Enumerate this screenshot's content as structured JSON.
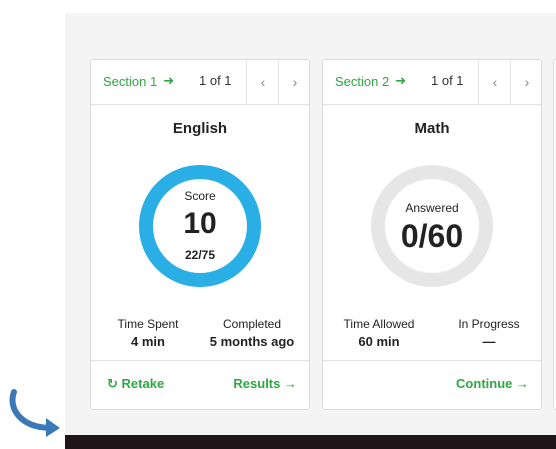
{
  "cards": [
    {
      "section_label": "Section 1",
      "page_count": "1 of 1",
      "subject": "English",
      "ring_label": "Score",
      "ring_value": "10",
      "ring_sub": "22/75",
      "ring_progress": 1.0,
      "ring_color": "#29aee6",
      "stat_left_label": "Time Spent",
      "stat_left_value": "4 min",
      "stat_right_label": "Completed",
      "stat_right_value": "5 months ago",
      "footer_left": "Retake",
      "footer_right": "Results"
    },
    {
      "section_label": "Section 2",
      "page_count": "1 of 1",
      "subject": "Math",
      "ring_label": "Answered",
      "ring_value": "0/60",
      "ring_progress": 0,
      "ring_color": "#e6e6e6",
      "stat_left_label": "Time Allowed",
      "stat_left_value": "60 min",
      "stat_right_label": "In Progress",
      "stat_right_value": "—",
      "footer_right": "Continue"
    }
  ],
  "colors": {
    "accent": "#2ea843",
    "ring_blue": "#29aee6",
    "arrow_blue": "#3b78b8",
    "bottom_bar": "#1f1418"
  },
  "icons": {
    "section_arrow": "arrow-right-icon",
    "prev": "chevron-left-icon",
    "next": "chevron-right-icon",
    "retake": "refresh-icon",
    "results": "arrow-right-icon"
  }
}
